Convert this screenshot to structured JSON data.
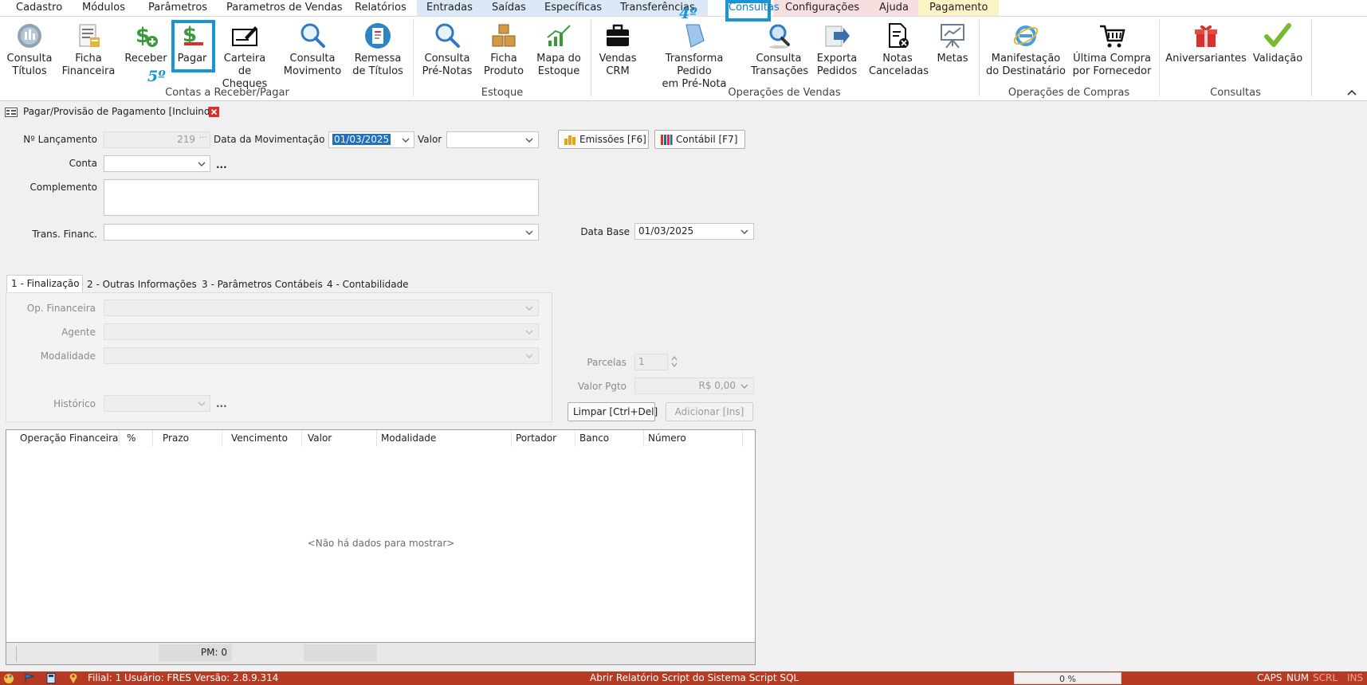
{
  "menu": {
    "items": [
      "Cadastro",
      "Módulos",
      "Parâmetros",
      "Parametros de Vendas",
      "Relatórios",
      "Entradas",
      "Saídas",
      "Específicas",
      "Transferências",
      "Consultas",
      "Configurações",
      "Ajuda",
      "Pagamento"
    ]
  },
  "annotations": {
    "step4": "4º",
    "step5": "5º"
  },
  "ribbon": {
    "buttons": [
      {
        "l1": "Consulta",
        "l2": "Títulos",
        "icon": "coins-icon"
      },
      {
        "l1": "Ficha",
        "l2": "Financeira",
        "icon": "ledger-icon"
      },
      {
        "l1": "Receber",
        "l2": "",
        "icon": "dollar-plus-icon"
      },
      {
        "l1": "Pagar",
        "l2": "",
        "icon": "dollar-minus-icon"
      },
      {
        "l1": "Carteira de",
        "l2": "Cheques",
        "icon": "checkbook-icon"
      },
      {
        "l1": "Consulta",
        "l2": "Movimento",
        "icon": "search-icon"
      },
      {
        "l1": "Remessa",
        "l2": "de Títulos",
        "icon": "remittance-icon"
      },
      {
        "l1": "Consulta",
        "l2": "Pré-Notas",
        "icon": "search-icon"
      },
      {
        "l1": "Ficha",
        "l2": "Produto",
        "icon": "boxes-icon"
      },
      {
        "l1": "Mapa do",
        "l2": "Estoque",
        "icon": "stock-chart-icon"
      },
      {
        "l1": "Vendas",
        "l2": "CRM",
        "icon": "briefcase-icon"
      },
      {
        "l1": "Transforma Pedido",
        "l2": "em Pré-Nota",
        "icon": "document-icon"
      },
      {
        "l1": "Consulta",
        "l2": "Transações",
        "icon": "magnifier-icon"
      },
      {
        "l1": "Exporta",
        "l2": "Pedidos",
        "icon": "export-arrow-icon"
      },
      {
        "l1": "Notas",
        "l2": "Canceladas",
        "icon": "cancelled-doc-icon"
      },
      {
        "l1": "Metas",
        "l2": "",
        "icon": "presentation-icon"
      },
      {
        "l1": "Manifestação",
        "l2": "do Destinatário",
        "icon": "ie-icon"
      },
      {
        "l1": "Última Compra",
        "l2": "por Fornecedor",
        "icon": "cart-icon"
      },
      {
        "l1": "Aniversariantes",
        "l2": "",
        "icon": "gift-icon"
      },
      {
        "l1": "Validação",
        "l2": "",
        "icon": "check-icon"
      }
    ],
    "groups": [
      "Contas a Receber/Pagar",
      "Estoque",
      "Operações de Vendas",
      "Operações de Compras",
      "Consultas"
    ]
  },
  "document_tab": {
    "title": "Pagar/Provisão de Pagamento [Incluindo]"
  },
  "form": {
    "n_lancamento_label": "Nº Lançamento",
    "n_lancamento_value": "219",
    "data_mov_label": "Data da Movimentação",
    "data_mov_value": "01/03/2025",
    "valor_label": "Valor",
    "valor_value": "",
    "emissoes_button": "Emissões [F6]",
    "contabil_button": "Contábil [F7]",
    "conta_label": "Conta",
    "conta_value": "",
    "ellipsis": "...",
    "complemento_label": "Complemento",
    "complemento_value": "",
    "trans_financ_label": "Trans. Financ.",
    "trans_financ_value": "",
    "data_base_label": "Data Base",
    "data_base_value": "01/03/2025"
  },
  "tabs": [
    "1 - Finalização",
    "2 - Outras Informações",
    "3 - Parâmetros Contábeis",
    "4 - Contabilidade"
  ],
  "finalizacao": {
    "op_financeira_label": "Op. Financeira",
    "agente_label": "Agente",
    "modalidade_label": "Modalidade",
    "historico_label": "Histórico",
    "parcelas_label": "Parcelas",
    "parcelas_value": "1",
    "valor_pgto_label": "Valor Pgto",
    "valor_pgto_value": "R$ 0,00",
    "limpar_button": "Limpar [Ctrl+Del]",
    "adicionar_button": "Adicionar [Ins]"
  },
  "grid": {
    "columns": [
      "Operação Financeira",
      "%",
      "Prazo",
      "Vencimento",
      "Valor",
      "Modalidade",
      "Portador",
      "Banco",
      "Número"
    ],
    "empty_text": "<Não há dados para mostrar>",
    "footer_pm": "PM: 0"
  },
  "statusbar": {
    "info": "Filial: 1   Usuário: FRES   Versão: 2.8.9.314",
    "actions": "Abrir Relatório   Script do Sistema   Script SQL",
    "progress": "0 %",
    "caps": "CAPS",
    "num": "NUM",
    "scrl": "SCRL",
    "ins": "INS"
  },
  "colors": {
    "accent": "#1a94d7",
    "statusbar": "#b73a23",
    "ribbon_bg": "#ffffff"
  }
}
